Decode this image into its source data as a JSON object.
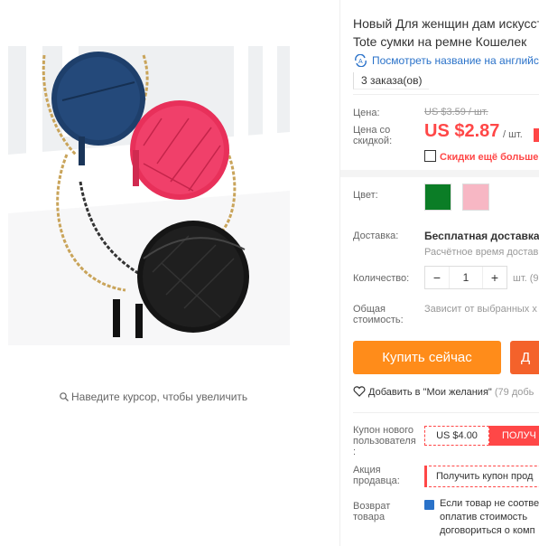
{
  "product": {
    "title_line1": "Новый Для женщин дам искусст",
    "title_line2": "Tote сумки на ремне Кошелек",
    "translate_link": "Посмотреть название на английс",
    "orders": "3 заказа(ов)"
  },
  "gallery": {
    "zoom_hint": "Наведите курсор, чтобы увеличить"
  },
  "price": {
    "label": "Цена:",
    "old": "US $3.59 / шт.",
    "discount_label_1": "Цена со",
    "discount_label_2": "скидкой:",
    "new": "US $2.87",
    "per_unit": "/ шт.",
    "more_discounts": "Скидки ещё больше i"
  },
  "options": {
    "color_label": "Цвет:",
    "colors": [
      "#0b7d26",
      "#f7b7c4"
    ]
  },
  "shipping": {
    "label": "Доставка:",
    "title": "Бесплатная доставка в",
    "subtitle": "Расчётное время достав"
  },
  "quantity": {
    "label": "Количество:",
    "minus": "−",
    "value": "1",
    "plus": "+",
    "unit": "шт. (9"
  },
  "total": {
    "label_1": "Общая",
    "label_2": "стоимость:",
    "value": "Зависит от выбранных х"
  },
  "actions": {
    "buy_now": "Купить сейчас",
    "add_to_cart": "Д",
    "wishlist": "Добавить в \"Мои желания\"",
    "wishlist_count": "(79 добь"
  },
  "coupons": {
    "new_user_label_1": "Купон нового",
    "new_user_label_2": "пользователя",
    "new_user_label_3": ":",
    "new_user_value": "US $4.00",
    "new_user_button": "ПОЛУЧ",
    "seller_label_1": "Акция",
    "seller_label_2": "продавца:",
    "seller_button": "Получить купон прод",
    "return_label_1": "Возврат",
    "return_label_2": "товара",
    "return_line1": "Если товар не соотве",
    "return_line2": "оплатив стоимость",
    "return_line3": "договориться о комп"
  }
}
